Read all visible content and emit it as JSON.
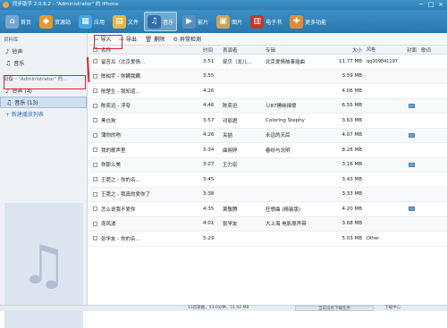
{
  "window": {
    "title": "同步助手 2.0.8.2 - \"Administrator\" 的 iPhone",
    "controls": [
      "─",
      "□",
      "×"
    ]
  },
  "toolbar": {
    "items": [
      {
        "label": "首页",
        "icon": "home-icon",
        "color": "#7aa6d1"
      },
      {
        "label": "资源站",
        "icon": "resource-icon",
        "color": "#e89a2b"
      },
      {
        "label": "应用",
        "icon": "apps-icon",
        "color": "#4aa7e0"
      },
      {
        "label": "文件",
        "icon": "folder-icon",
        "color": "#e6b84a"
      },
      {
        "label": "音乐",
        "icon": "music-icon",
        "color": "#2e6ea8"
      },
      {
        "label": "影片",
        "icon": "video-icon",
        "color": "#5a8fc2"
      },
      {
        "label": "图片",
        "icon": "photo-icon",
        "color": "#c9a35a"
      },
      {
        "label": "电子书",
        "icon": "ebook-icon",
        "color": "#c0392b"
      },
      {
        "label": "更多功能",
        "icon": "more-icon",
        "color": "#e58a2e"
      }
    ]
  },
  "sidebar": {
    "library_title": "资料库",
    "library_items": [
      {
        "label": "铃声",
        "icon": "bell-icon"
      },
      {
        "label": "音乐",
        "icon": "note-icon"
      }
    ],
    "device_title": "设备 - \"Administrator\" 的...",
    "device_items": [
      {
        "label": "铃声 (4)",
        "icon": "bell-icon"
      },
      {
        "label": "音乐 (13)",
        "icon": "note-icon"
      }
    ],
    "new_playlist": "+ 新建播放列表"
  },
  "actions": {
    "import": "导入",
    "export": "导出",
    "delete": "删除",
    "check": "异常检测"
  },
  "columns": {
    "name": "名称",
    "time": "时间",
    "artist": "表演者",
    "album": "专辑",
    "size": "大小",
    "style": "风格",
    "cover": "封面",
    "lyrics": "歌词"
  },
  "songs": [
    {
      "name": "留苦瓜（北京爱情...",
      "time": "3:51",
      "artist": "捉贝（龙儿...",
      "album": "北京爱情故事插曲",
      "size": "11.77 MB",
      "style": "qq309841197",
      "cover": false
    },
    {
      "name": "陈柏宇 - 你瞒我瞒",
      "time": "3:55",
      "artist": "",
      "album": "",
      "size": "3.59 MB",
      "style": "",
      "cover": false
    },
    {
      "name": "陈楚生 - 我知道...",
      "time": "4:26",
      "artist": "",
      "album": "",
      "size": "4.06 MB",
      "style": "",
      "cover": false
    },
    {
      "name": "陈奕迅 - 浮夸",
      "time": "4:46",
      "artist": "陈奕迅",
      "album": "Ｕ87睡純禄傻",
      "size": "6.55 MB",
      "style": "",
      "cover": true
    },
    {
      "name": "黑白狗",
      "time": "3:57",
      "artist": "邓丽君",
      "album": "Coloring Stephy",
      "size": "3.63 MB",
      "style": "",
      "cover": false
    },
    {
      "name": "蒲你的吻",
      "time": "4:26",
      "artist": "关喆",
      "album": "永远的天后",
      "size": "4.07 MB",
      "style": "",
      "cover": true
    },
    {
      "name": "我的歌声里",
      "time": "3:34",
      "artist": "曲婉婷",
      "album": "春纷与沈明",
      "size": "8.28 MB",
      "style": "",
      "cover": false
    },
    {
      "name": "你那么美",
      "time": "3:27",
      "artist": "王力宏",
      "album": "",
      "size": "3.16 MB",
      "style": "",
      "cover": true
    },
    {
      "name": "王菀之 - 你的名...",
      "time": "3:45",
      "artist": "",
      "album": "",
      "size": "3.43 MB",
      "style": "",
      "cover": false
    },
    {
      "name": "王菀之 - 我真的爱你了",
      "time": "3:38",
      "artist": "",
      "album": "",
      "size": "3.33 MB",
      "style": "",
      "cover": false
    },
    {
      "name": "怎么说我不爱你",
      "time": "4:35",
      "artist": "萧敬腾",
      "album": "狂想曲 (精装版)",
      "size": "4.20 MB",
      "style": "",
      "cover": true
    },
    {
      "name": "宠风波",
      "time": "4:01",
      "artist": "张学友",
      "album": "大上海 电影原声带",
      "size": "3.68 MB",
      "style": "",
      "cover": false
    },
    {
      "name": "张学友 - 你的名...",
      "time": "5:29",
      "artist": "",
      "album": "",
      "size": "5.03 MB",
      "style": "Other",
      "cover": false
    }
  ],
  "status": {
    "summary": "13首歌曲，53.0分钟，51.92 MB",
    "task": "当前没有下载任务",
    "download": "下载中心"
  }
}
